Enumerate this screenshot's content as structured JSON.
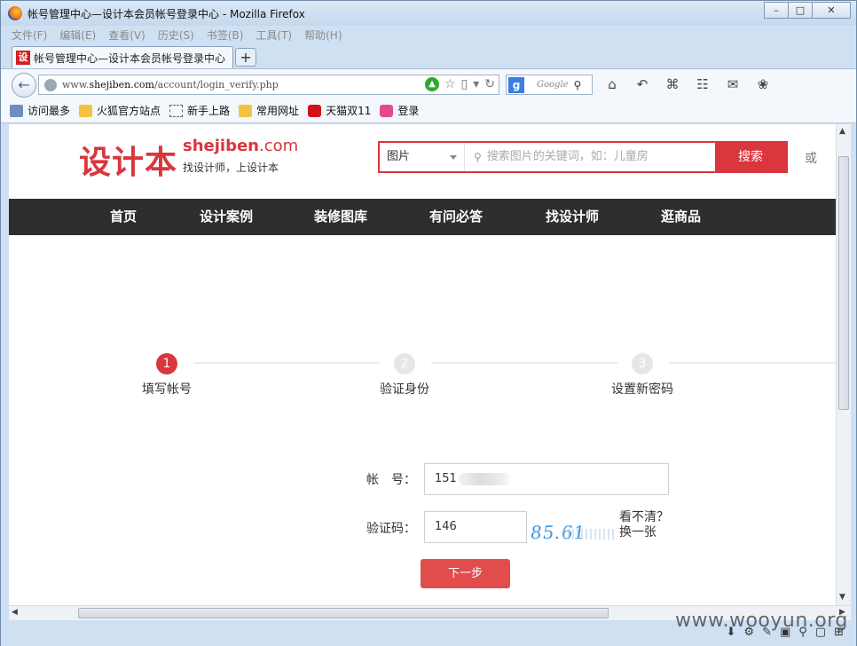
{
  "window": {
    "title": "帐号管理中心—设计本会员帐号登录中心 - Mozilla Firefox"
  },
  "menubar": {
    "items": [
      "文件(F)",
      "编辑(E)",
      "查看(V)",
      "历史(S)",
      "书签(B)",
      "工具(T)",
      "帮助(H)"
    ]
  },
  "tab": {
    "favicon": "设",
    "title": "帐号管理中心—设计本会员帐号登录中心",
    "new_tab": "+"
  },
  "navbar": {
    "url_prefix": "www.",
    "url_domain": "shejiben.com",
    "url_path": "/account/login_verify.php",
    "search_engine": "Google"
  },
  "bookmarks": [
    {
      "label": "访问最多",
      "icon": "bookmark-icon"
    },
    {
      "label": "火狐官方站点",
      "icon": "folder-icon"
    },
    {
      "label": "新手上路",
      "icon": "dashed-box-icon"
    },
    {
      "label": "常用网址",
      "icon": "folder-icon"
    },
    {
      "label": "天猫双11",
      "icon": "tmall-icon"
    },
    {
      "label": "登录",
      "icon": "login-icon"
    }
  ],
  "site": {
    "logo_cn": "设计本",
    "logo_en_bold": "shejiben",
    "logo_en_rest": ".com",
    "slogan": "找设计师，上设计本",
    "search_category": "图片",
    "search_placeholder": "搜索图片的关键词，如：儿童房",
    "search_button": "搜索",
    "or_text": "或"
  },
  "nav": {
    "items": [
      "首页",
      "设计案例",
      "装修图库",
      "有问必答",
      "找设计师",
      "逛商品"
    ]
  },
  "steps": [
    {
      "num": "1",
      "label": "填写帐号",
      "active": true
    },
    {
      "num": "2",
      "label": "验证身份",
      "active": false
    },
    {
      "num": "3",
      "label": "设置新密码",
      "active": false
    }
  ],
  "form": {
    "account_label": "帐　号：",
    "account_value": "151",
    "captcha_label": "验证码：",
    "captcha_value": "146",
    "captcha_image_text": "85.61",
    "refresh_line1": "看不清？",
    "refresh_line2": "换一张",
    "next_button": "下一步"
  },
  "watermark": "www.wooyun.org",
  "colors": {
    "brand_red": "#d9363e",
    "nav_bg": "#2e2e2e",
    "button_red": "#e14d4d",
    "captcha_blue": "#3f96dc"
  }
}
